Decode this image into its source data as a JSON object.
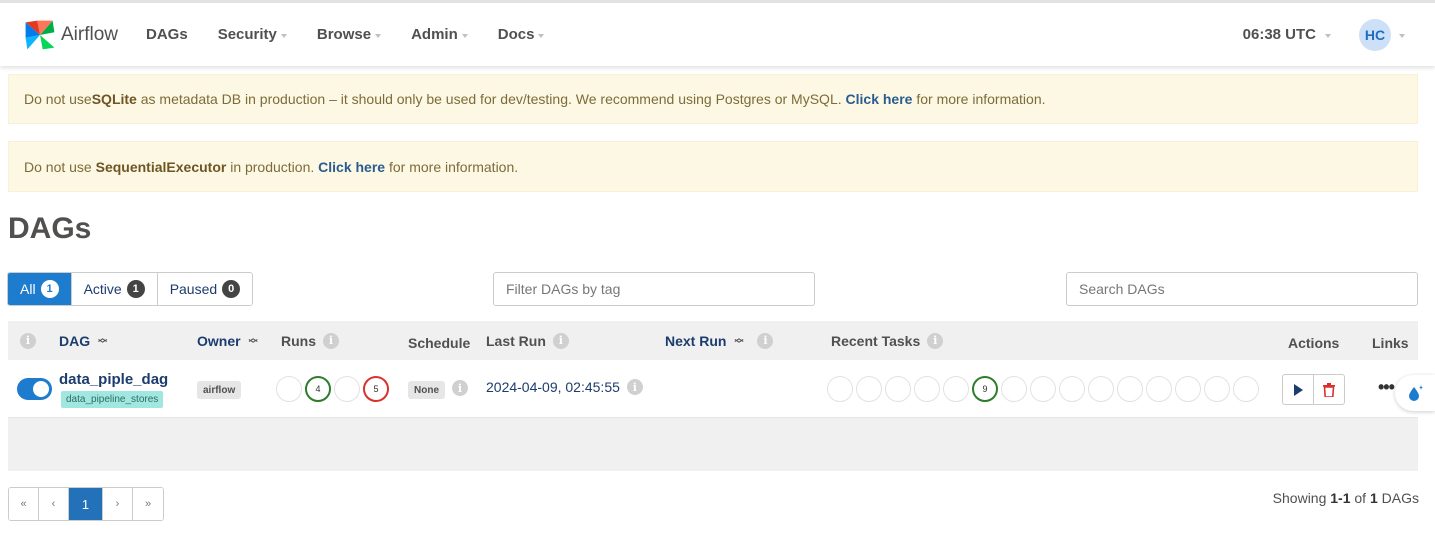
{
  "nav": {
    "brand": "Airflow",
    "items": [
      "DAGs",
      "Security",
      "Browse",
      "Admin",
      "Docs"
    ],
    "time": "06:38 UTC",
    "avatar": "HC"
  },
  "alerts": {
    "sqlite": {
      "pre": "Do not use ",
      "bold": "SQLite",
      "mid": " as metadata DB in production – it should only be used for dev/testing. We recommend using Postgres or MySQL. ",
      "link": "Click here",
      "post": " for more information."
    },
    "executor": {
      "pre": "Do not use ",
      "bold": "SequentialExecutor",
      "mid": " in production. ",
      "link": "Click here",
      "post": " for more information."
    }
  },
  "page_title": "DAGs",
  "filters": {
    "all": {
      "label": "All",
      "count": "1"
    },
    "active": {
      "label": "Active",
      "count": "1"
    },
    "paused": {
      "label": "Paused",
      "count": "0"
    }
  },
  "tag_filter_placeholder": "Filter DAGs by tag",
  "search_placeholder": "Search DAGs",
  "table": {
    "headers": {
      "dag": "DAG",
      "owner": "Owner",
      "runs": "Runs",
      "schedule": "Schedule",
      "last_run": "Last Run",
      "next_run": "Next Run",
      "recent_tasks": "Recent Tasks",
      "actions": "Actions",
      "links": "Links"
    },
    "rows": [
      {
        "dag_id": "data_piple_dag",
        "tag": "data_pipeline_stores",
        "owner": "airflow",
        "runs": {
          "success": "4",
          "failed": "5"
        },
        "schedule": "None",
        "last_run": "2024-04-09, 02:45:55",
        "recent_tasks_success": "9"
      }
    ]
  },
  "pagination": {
    "first": "«",
    "prev": "‹",
    "current": "1",
    "next": "›",
    "last": "»"
  },
  "showing": {
    "pre": "Showing ",
    "range": "1-1",
    "mid": " of ",
    "total": "1",
    "post": " DAGs"
  },
  "colors": {
    "primary": "#1e7ccf",
    "success": "#2d7d2d",
    "failed": "#d9302c",
    "alert_bg": "#fcf8e3"
  }
}
